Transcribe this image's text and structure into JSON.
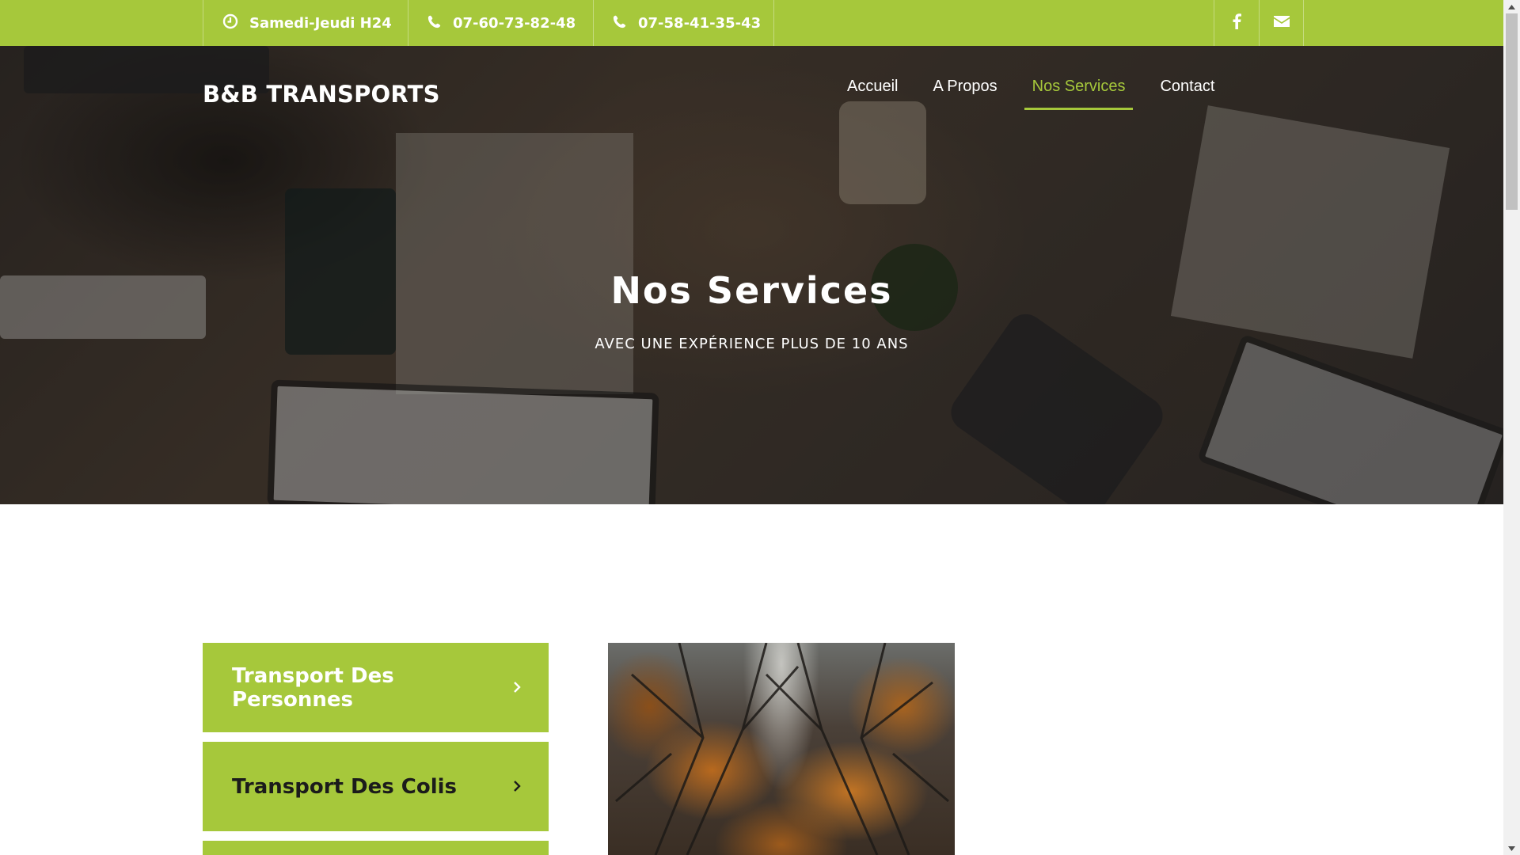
{
  "topbar": {
    "hours": "Samedi-Jeudi H24",
    "phone1": "07-60-73-82-48",
    "phone2": "07-58-41-35-43",
    "social": [
      "facebook-icon",
      "envelope-icon"
    ],
    "color": "#a6c83b"
  },
  "header": {
    "logo": "B&B TRANSPORTS",
    "nav": [
      {
        "label": "Accueil",
        "active": false
      },
      {
        "label": "A Propos",
        "active": false
      },
      {
        "label": "Nos Services",
        "active": true
      },
      {
        "label": "Contact",
        "active": false
      }
    ]
  },
  "hero": {
    "title": "Nos Services",
    "subtitle": "AVEC UNE EXPÉRIENCE PLUS DE 10 ANS"
  },
  "services": [
    {
      "label": "Transport Des Personnes"
    },
    {
      "label": "Transport Des Colis"
    }
  ],
  "colors": {
    "accent": "#a6c83b",
    "dark_text": "#1b1b1b"
  }
}
